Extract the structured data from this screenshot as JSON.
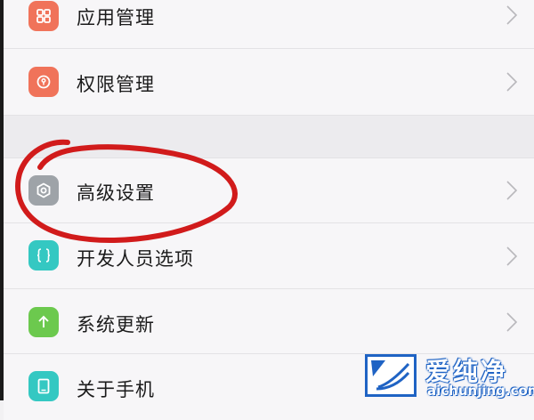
{
  "settings_list": {
    "items": [
      {
        "label": "应用管理",
        "icon": "grid-icon",
        "icon_color": "#f0735a"
      },
      {
        "label": "权限管理",
        "icon": "lock-icon",
        "icon_color": "#f0735a"
      },
      {
        "label": "高级设置",
        "icon": "gear-icon",
        "icon_color": "#9ea3a8"
      },
      {
        "label": "开发人员选项",
        "icon": "braces-icon",
        "icon_color": "#34c8c2"
      },
      {
        "label": "系统更新",
        "icon": "arrow-up-icon",
        "icon_color": "#6cc94e"
      },
      {
        "label": "关于手机",
        "icon": "phone-icon",
        "icon_color": "#34c8c2"
      }
    ]
  },
  "annotation": {
    "color": "#d11b1b"
  },
  "watermark": {
    "title": "爱纯净",
    "url": "aichunjing.com",
    "accent": "#1f63c4"
  }
}
